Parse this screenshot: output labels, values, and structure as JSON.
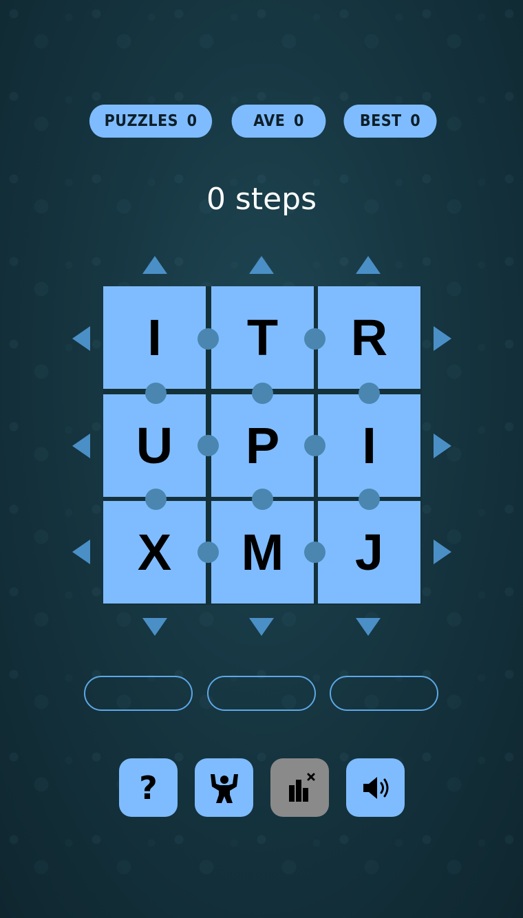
{
  "stats": {
    "puzzles_label": "PUZZLES",
    "puzzles_value": "0",
    "ave_label": "AVE",
    "ave_value": "0",
    "best_label": "BEST",
    "best_value": "0"
  },
  "steps_text": "0 steps",
  "board": {
    "tiles": [
      "I",
      "T",
      "R",
      "U",
      "P",
      "I",
      "X",
      "M",
      "J"
    ]
  },
  "answers": [
    "",
    "",
    ""
  ],
  "buttons": {
    "help_label": "?",
    "help_icon": "question-mark-icon",
    "strength_icon": "strongman-icon",
    "stats_icon": "bar-chart-x-icon",
    "sound_icon": "speaker-volume-icon"
  },
  "colors": {
    "tile": "#7fbcff",
    "dot": "#4a86b0",
    "arrow": "#4b8fc7",
    "disabled_button": "#8a8a8a"
  }
}
